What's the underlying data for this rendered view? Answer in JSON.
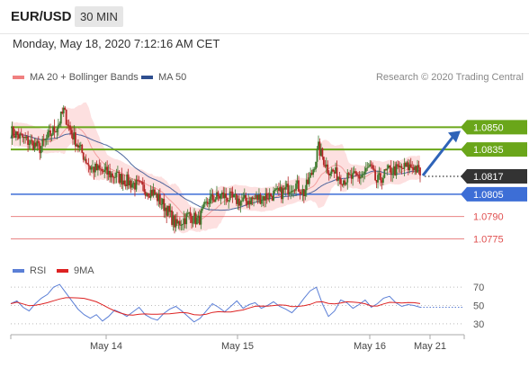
{
  "header": {
    "pair": "EUR/USD",
    "timeframe": "30 MIN"
  },
  "timestamp": "Monday, May 18, 2020 7:12:16 AM CET",
  "credit": "Research © 2020 Trading Central",
  "colors": {
    "resistance": "#6aa61a",
    "support": "#3d6ed6",
    "pivot_support": "#e05050",
    "ma50": "#2f4f8f",
    "bollinger_band": "#fde0e0",
    "price_current": "#333333",
    "arrow": "#2e63b8",
    "rsi": "#5b7fd6",
    "rsi_ma": "#dd2222"
  },
  "chart_data": [
    {
      "type": "candlestick",
      "legend": [
        {
          "name": "MA 20 + Bollinger Bands",
          "color": "#f08080"
        },
        {
          "name": "MA 50",
          "color": "#2f4f8f"
        }
      ],
      "x_ticks": [
        "May 14",
        "May 15",
        "May 16",
        "May 21"
      ],
      "ylim": [
        1.0765,
        1.0875
      ],
      "levels": [
        {
          "value": 1.085,
          "label": "1.0850",
          "kind": "resistance",
          "style": "tag"
        },
        {
          "value": 1.0835,
          "label": "1.0835",
          "kind": "resistance",
          "style": "tag"
        },
        {
          "value": 1.0817,
          "label": "1.0817",
          "kind": "current",
          "style": "tag"
        },
        {
          "value": 1.0805,
          "label": "1.0805",
          "kind": "support",
          "style": "tag"
        },
        {
          "value": 1.079,
          "label": "1.0790",
          "kind": "support2",
          "style": "text"
        },
        {
          "value": 1.0775,
          "label": "1.0775",
          "kind": "support2",
          "style": "text"
        }
      ],
      "close_anchors": [
        [
          0,
          1.0847
        ],
        [
          12,
          1.0841
        ],
        [
          22,
          1.0836
        ],
        [
          28,
          1.0843
        ],
        [
          36,
          1.0852
        ],
        [
          40,
          1.0861
        ],
        [
          45,
          1.0848
        ],
        [
          52,
          1.0836
        ],
        [
          60,
          1.0823
        ],
        [
          70,
          1.082
        ],
        [
          80,
          1.0817
        ],
        [
          95,
          1.0811
        ],
        [
          108,
          1.0806
        ],
        [
          118,
          1.0795
        ],
        [
          125,
          1.0784
        ],
        [
          135,
          1.0791
        ],
        [
          142,
          1.0787
        ],
        [
          150,
          1.0801
        ],
        [
          160,
          1.0804
        ],
        [
          175,
          1.08
        ],
        [
          190,
          1.0803
        ],
        [
          205,
          1.0806
        ],
        [
          215,
          1.0812
        ],
        [
          222,
          1.0806
        ],
        [
          228,
          1.0819
        ],
        [
          233,
          1.0836
        ],
        [
          240,
          1.0822
        ],
        [
          252,
          1.0815
        ],
        [
          265,
          1.0817
        ],
        [
          272,
          1.0823
        ],
        [
          277,
          1.0813
        ],
        [
          285,
          1.082
        ],
        [
          295,
          1.0822
        ],
        [
          305,
          1.0824
        ],
        [
          310,
          1.0819
        ]
      ],
      "forecast_target": 1.085,
      "rsi": {
        "legend": [
          {
            "name": "RSI",
            "color": "#5b7fd6"
          },
          {
            "name": "9MA",
            "color": "#dd2222"
          }
        ],
        "ylim": [
          20,
          80
        ],
        "levels": [
          70,
          50,
          30
        ],
        "values": [
          52,
          55,
          48,
          44,
          52,
          58,
          62,
          70,
          73,
          64,
          55,
          46,
          40,
          36,
          40,
          33,
          38,
          45,
          42,
          38,
          43,
          48,
          40,
          36,
          34,
          41,
          46,
          49,
          44,
          38,
          32,
          36,
          44,
          52,
          48,
          43,
          49,
          55,
          47,
          51,
          53,
          47,
          50,
          54,
          49,
          46,
          42,
          49,
          58,
          66,
          70,
          52,
          38,
          44,
          56,
          53,
          47,
          51,
          56,
          48,
          52,
          58,
          60,
          53,
          49,
          51,
          50,
          48
        ]
      }
    }
  ]
}
